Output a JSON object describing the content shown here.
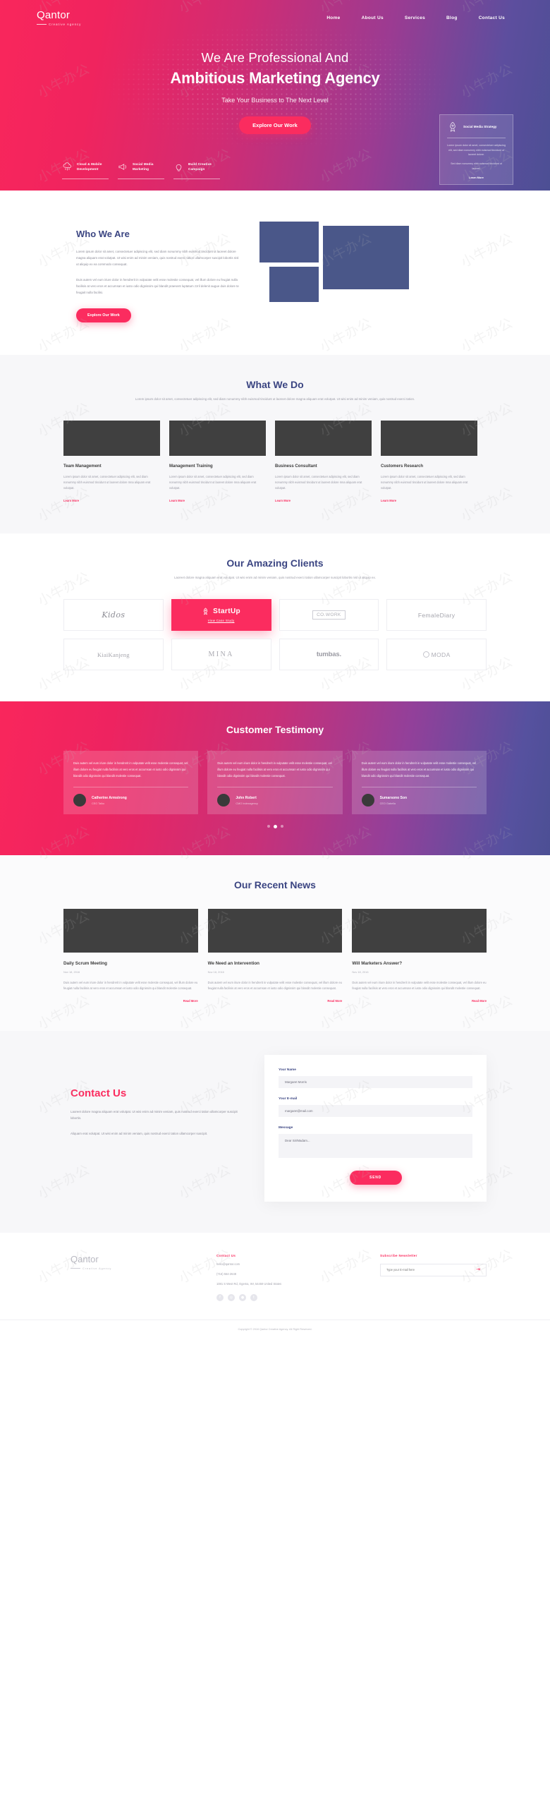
{
  "brand": {
    "name": "Qantor",
    "tagline": "Creative Agency",
    "accent": "#fb2c5f",
    "navy": "#3b4582"
  },
  "nav": {
    "items": [
      {
        "label": "Home",
        "active": true
      },
      {
        "label": "About Us",
        "active": false
      },
      {
        "label": "Services",
        "active": false
      },
      {
        "label": "Blog",
        "active": false
      },
      {
        "label": "Contact Us",
        "active": false
      }
    ]
  },
  "hero": {
    "headline_light": "We Are Professional And",
    "headline_bold": "Ambitious Marketing Agency",
    "subtitle": "Take Your Business to The Next Level",
    "cta": "Explore Our Work",
    "services": [
      {
        "icon": "cloud-icon",
        "label": "Cloud & Mobile Development"
      },
      {
        "icon": "megaphone-icon",
        "label": "Social Media Marketing"
      },
      {
        "icon": "lightbulb-icon",
        "label": "Build Creative Campaign"
      }
    ],
    "card": {
      "icon": "rocket-icon",
      "title": "Social Media Strategy",
      "p1": "Lorem ipsum dolor sit amet, consectetuer adipiscing elit, sed diam nonummy nibh euismod tincidunt ut laoreet dolore.",
      "p2": "Sed diam nonummy nibh euismod tincidunt ut laoreet.",
      "link": "Learn More"
    }
  },
  "who": {
    "title": "Who We Are",
    "p1": "Lorem ipsum dolor sit amet, consectetuer adipiscing elit, sed diam nonummy nibh euismod tincidunt ut laoreet dolore magna aliquam erat volutpat. Ut wisi enim ad minim veniam, quis nostrud exerci tation ullamcorper suscipit lobortis nisl ut aliquip ex ea commodo consequat.",
    "p2": "Duis autem vel eum iriure dolor in hendrerit in vulputate velit esse molestie consequat, vel illum dolore eu feugiat nulla facilisis at vero eros et accumsan et iusto odio dignissim qui blandit praesent luptatum zzril delenit augue duis dolore te feugait nulla facilisi.",
    "cta": "Explore Our Work"
  },
  "whatwedo": {
    "title": "What We Do",
    "desc": "Lorem ipsum dolor sit amet, consectetuer adipiscing elit, sed diam nonummy nibh euismod tincidunt ut laoreet dolore magna aliquam erat volutpat. Ut wisi enim ad minim veniam, quis nostrud exerci tation.",
    "cards": [
      {
        "title": "Team Management",
        "body": "Lorem ipsum dolor sit amet, consectetuer adipiscing elit, sed diam nonummy nibh euismod tincidunt ut laoreet dolore mna aliquam erat volutpat.",
        "link": "Learn More"
      },
      {
        "title": "Management Training",
        "body": "Lorem ipsum dolor sit amet, consectetuer adipiscing elit, sed diam nonummy nibh euismod tincidunt ut laoreet dolore mna aliquam erat volutpat.",
        "link": "Learn More"
      },
      {
        "title": "Business Consultant",
        "body": "Lorem ipsum dolor sit amet, consectetuer adipiscing elit, sed diam nonummy nibh euismod tincidunt ut laoreet dolore mna aliquam erat volutpat.",
        "link": "Learn More"
      },
      {
        "title": "Customers Research",
        "body": "Lorem ipsum dolor sit amet, consectetuer adipiscing elit, sed diam nonummy nibh euismod tincidunt ut laoreet dolore mna aliquam erat volutpat.",
        "link": "Learn More"
      }
    ]
  },
  "clients": {
    "title": "Our Amazing Clients",
    "desc": "Laoreet dolore magna aliquam erat volutpat. Ut wisi enim ad minim veniam, quis nostrud exerci tation ullamcorper suscipit lobortis nisl ut aliquip ex.",
    "logos": [
      {
        "name": "Kidos",
        "style": "kidos",
        "active": false
      },
      {
        "name": "StartUp",
        "style": "startup",
        "active": true,
        "case_link": "View Case Study"
      },
      {
        "name": "CO.WORK",
        "style": "cowork",
        "active": false
      },
      {
        "name": "FemaleDiary",
        "style": "female",
        "active": false
      },
      {
        "name": "KiaiKanjeng",
        "style": "kiai",
        "active": false
      },
      {
        "name": "MINA",
        "style": "mina",
        "active": false
      },
      {
        "name": "tumbas.",
        "style": "tumbas",
        "active": false
      },
      {
        "name": "MODA",
        "style": "moda",
        "active": false
      }
    ]
  },
  "testimony": {
    "title": "Customer Testimony",
    "items": [
      {
        "quote": "Duis autem vel eum iriure dolor in hendrerit in vulputate velit esse molestie consequat, vel illum dolore eu feugiat nulla facilisis at vero eros et accumsan et iusto odio dignissim qui blandit odio dignissim qui blandit molestie consequat.",
        "name": "Catherine Armstrong",
        "role": "CEO Talko"
      },
      {
        "quote": "Duis autem vel eum iriure dolor in hendrerit in vulputate velit esse molestie consequat, vel illum dolore eu feugiat nulla facilisis at vero eros et accumsan et iusto odio dignissim qui blandit odio dignissim qui blandit molestie consequat.",
        "name": "John Robert",
        "role": "CMO Indexagency"
      },
      {
        "quote": "Duis autem vel eum iriure dolor in hendrerit in vulputate velit esse molestie consequat, vel illum dolore eu feugiat nulla facilisis at vero eros et accumsan et iusto odio dignissim qui blandit odio dignissim qui blandit molestie consequat.",
        "name": "Sumarsono Son",
        "role": "CEO Gabella"
      }
    ],
    "dots": 3,
    "active_dot": 1
  },
  "news": {
    "title": "Our Recent News",
    "items": [
      {
        "title": "Daily Scrum Meeting",
        "date": "Nov 18, 2016",
        "body": "Duis autem vel eum iriure dolor in hendrerit in vulputate velit esse molestie consequat, vel illum dolore eu feugiat nulla facilisis at vero eros et accumsan et iusto odio dignissim qui blandit molestie consequat.",
        "link": "Read More"
      },
      {
        "title": "We Need an Intervention",
        "date": "Nov 18, 2016",
        "body": "Duis autem vel eum iriure dolor in hendrerit in vulputate velit esse molestie consequat, vel illum dolore eu feugiat nulla facilisis at vero eros et accumsan et iusto odio dignissim qui blandit molestie consequat.",
        "link": "Read More"
      },
      {
        "title": "Will Marketers Answer?",
        "date": "Nov 18, 2016",
        "body": "Duis autem vel eum iriure dolor in hendrerit in vulputate velit esse molestie consequat, vel illum dolore eu feugiat nulla facilisis at vero eros et accumsan et iusto odio dignissim qui blandit molestie consequat.",
        "link": "Read More"
      }
    ]
  },
  "contact": {
    "title": "Contact Us",
    "p1": "Laoreet dolore magna aliquam erat volutpat. Ut wisi enim ad minim veniam, quis nostrud exerci tation ullamcorper suscipit lobortis.",
    "p2": "Aliquam erat volutpat. Ut wisi enim ad minim veniam, quis nostrud exerci tation ullamcorper suscipit.",
    "form": {
      "name_label": "Your Name",
      "name_value": "Margaret Morris",
      "email_label": "Your E-mail",
      "email_value": "margaret@mail.com",
      "message_label": "Message",
      "message_value": "Dear Sir/Madam...",
      "send_label": "SEND"
    }
  },
  "footer": {
    "contact_heading": "Contact Us",
    "email": "hello@qantor.com",
    "phone": "(716) 564-2648",
    "address": "1081 S West Rd, Ogema, WI, 54459 United States",
    "social": [
      "facebook-icon",
      "instagram-icon",
      "dribbble-icon",
      "twitter-icon"
    ],
    "newsletter_heading": "Subscribe Newsletter",
    "newsletter_placeholder": "Type your E-mail here",
    "copyright": "Copyright  © 2016 Qantor Creative Agency. All Right Reserved."
  },
  "watermark": {
    "text": "小牛办公"
  }
}
